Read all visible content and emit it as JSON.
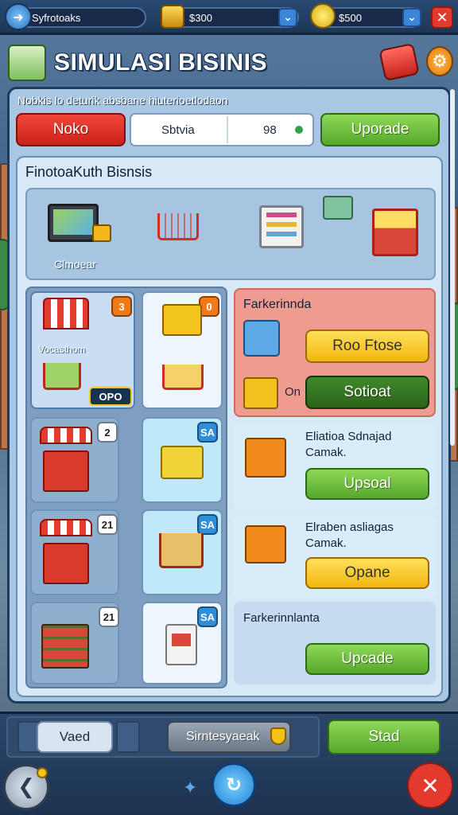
{
  "topbar": {
    "player_name": "Syfrotoaks",
    "coins_value": "$300",
    "gems_value": "$500"
  },
  "header": {
    "title": "SIMULASI BISINIS"
  },
  "notice": "Nobkis lo deturik absbane hiuterioetlodaon",
  "controls": {
    "tab_label": "Noko",
    "field_label": "Sbtvia",
    "field_value": "98",
    "upgrade_label": "Uporade"
  },
  "main": {
    "section_title": "FinotoaKuth Bisnsis",
    "hero_label": "Clmoear",
    "cards": [
      {
        "badge": "3",
        "label": "Vocasthom",
        "price": "OPO"
      },
      {
        "badge": "0"
      },
      {
        "badge": "2"
      },
      {
        "badge": "SA"
      },
      {
        "badge": "21"
      },
      {
        "badge": "SA"
      },
      {
        "badge": "21"
      },
      {
        "badge": "SA"
      }
    ],
    "detail": {
      "title": "Farkerinnda",
      "primary_button": "Roo Ftose",
      "side_label": "On",
      "secondary_button": "Sotioat"
    },
    "offers": [
      {
        "title": "Eliatioa Sdnajad",
        "subtitle": "Camak.",
        "button": "Upsoal"
      },
      {
        "title": "Elraben asliagas",
        "subtitle": "Camak.",
        "button": "Opane"
      }
    ],
    "bottom_detail": {
      "title": "Farkerinnlanta",
      "button": "Upcade"
    }
  },
  "footer": {
    "left_label": "Vaed",
    "mid_label": "Sirntesyaeak",
    "right_label": "Stad"
  },
  "colors": {
    "green": "#6fc03c",
    "yellow": "#f6c927",
    "red": "#e23a2e",
    "panel": "#cfe2f3"
  }
}
